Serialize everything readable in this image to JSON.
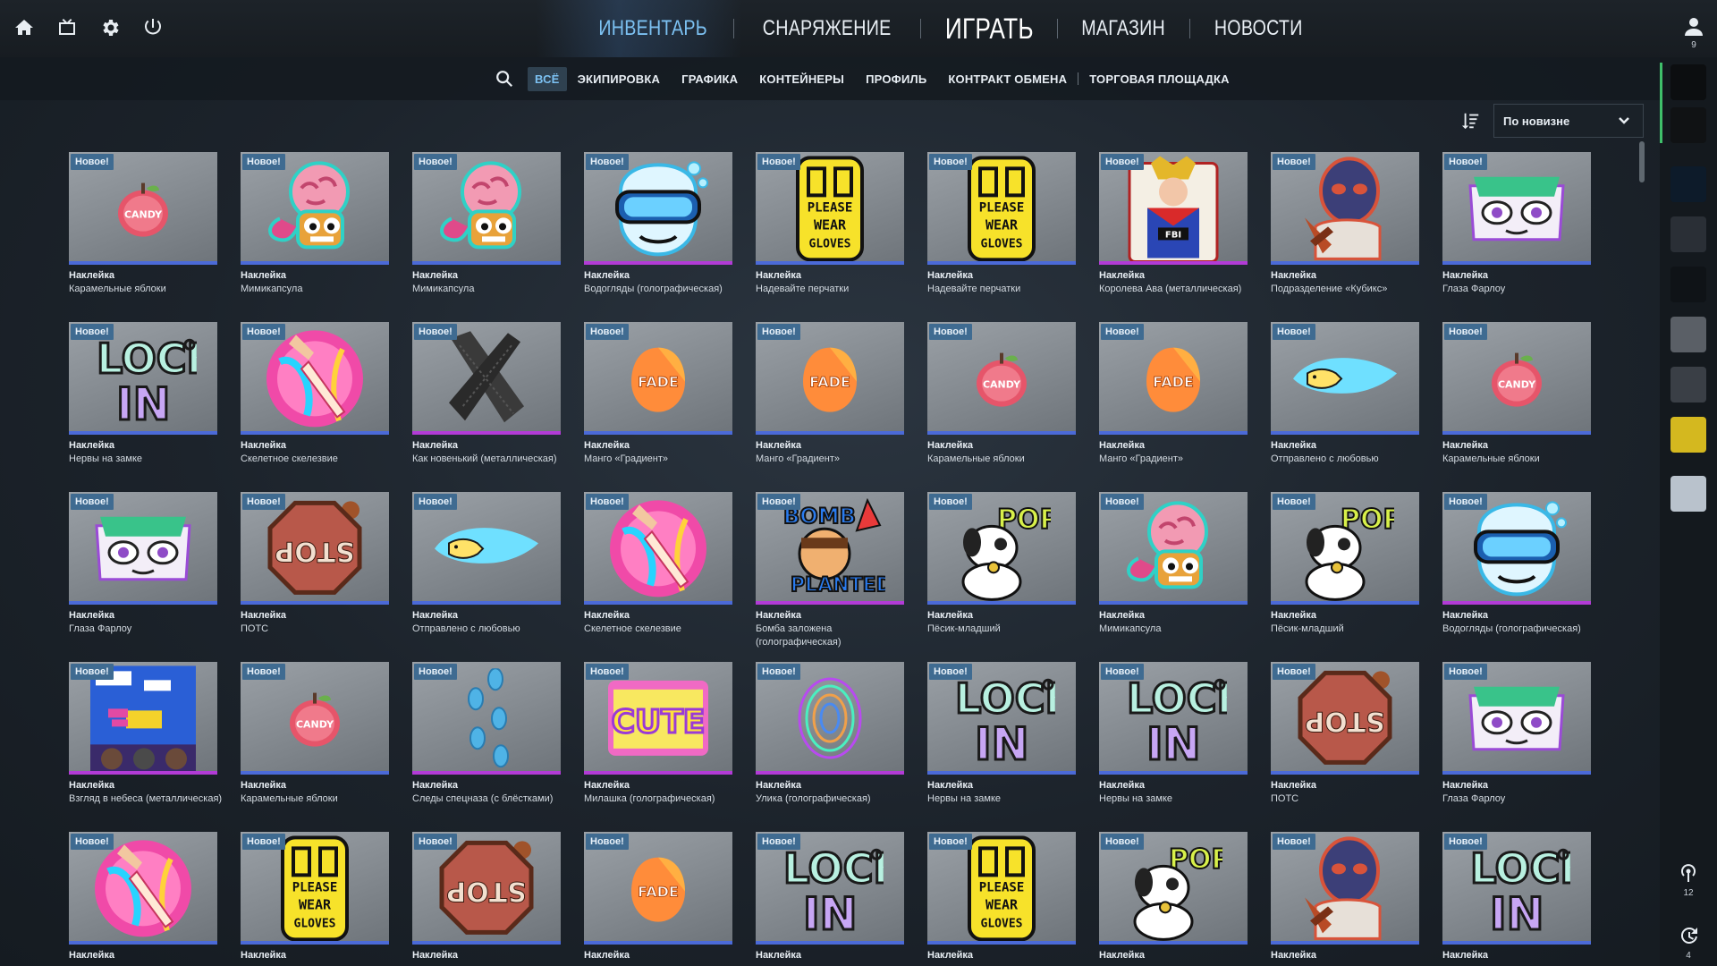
{
  "nav": {
    "items": [
      "ИНВЕНТАРЬ",
      "СНАРЯЖЕНИЕ",
      "ИГРАТЬ",
      "МАГАЗИН",
      "НОВОСТИ"
    ],
    "active": "ИНВЕНТАРЬ"
  },
  "user": {
    "friends_count": "9"
  },
  "subnav": {
    "items": [
      "ВСЁ",
      "ЭКИПИРОВКА",
      "ГРАФИКА",
      "КОНТЕЙНЕРЫ",
      "ПРОФИЛЬ",
      "КОНТРАКТ ОБМЕНА",
      "ТОРГОВАЯ ПЛОЩАДКА"
    ],
    "active": "ВСЁ"
  },
  "sort": {
    "selected": "По новизне"
  },
  "badge_text": "Новое!",
  "colors": {
    "accent": "#7cc1f2",
    "badge": "#3f6b91",
    "rarity_blue": "#4b6ad8",
    "rarity_pink": "#b23bd6"
  },
  "items": [
    {
      "type": "Наклейка",
      "name": "Карамельные яблоки",
      "art": "apple",
      "rarity": "blue"
    },
    {
      "type": "Наклейка",
      "name": "Мимикапсула",
      "art": "brain",
      "rarity": "blue"
    },
    {
      "type": "Наклейка",
      "name": "Мимикапсула",
      "art": "brain",
      "rarity": "blue"
    },
    {
      "type": "Наклейка",
      "name": "Водогляды (голографическая)",
      "art": "goggles",
      "rarity": "pink"
    },
    {
      "type": "Наклейка",
      "name": "Надевайте перчатки",
      "art": "gloves",
      "rarity": "blue"
    },
    {
      "type": "Наклейка",
      "name": "Надевайте перчатки",
      "art": "gloves",
      "rarity": "blue"
    },
    {
      "type": "Наклейка",
      "name": "Королева Ава (металлическая)",
      "art": "queen",
      "rarity": "pink"
    },
    {
      "type": "Наклейка",
      "name": "Подразделение «Кубикс»",
      "art": "mask",
      "rarity": "blue"
    },
    {
      "type": "Наклейка",
      "name": "Глаза Фарлоу",
      "art": "eyes",
      "rarity": "blue"
    },
    {
      "type": "Наклейка",
      "name": "Нервы на замке",
      "art": "lockin",
      "rarity": "blue"
    },
    {
      "type": "Наклейка",
      "name": "Скелетное скелезвие",
      "art": "knife",
      "rarity": "blue"
    },
    {
      "type": "Наклейка",
      "name": "Как новенький (металлическая)",
      "art": "tape",
      "rarity": "pink"
    },
    {
      "type": "Наклейка",
      "name": "Манго «Градиент»",
      "art": "mango",
      "rarity": "blue"
    },
    {
      "type": "Наклейка",
      "name": "Манго «Градиент»",
      "art": "mango",
      "rarity": "blue"
    },
    {
      "type": "Наклейка",
      "name": "Карамельные яблоки",
      "art": "apple",
      "rarity": "blue"
    },
    {
      "type": "Наклейка",
      "name": "Манго «Градиент»",
      "art": "mango",
      "rarity": "blue"
    },
    {
      "type": "Наклейка",
      "name": "Отправлено с любовью",
      "art": "bullet",
      "rarity": "blue"
    },
    {
      "type": "Наклейка",
      "name": "Карамельные яблоки",
      "art": "apple",
      "rarity": "blue"
    },
    {
      "type": "Наклейка",
      "name": "Глаза Фарлоу",
      "art": "eyes",
      "rarity": "blue"
    },
    {
      "type": "Наклейка",
      "name": "ПОТС",
      "art": "stop",
      "rarity": "blue"
    },
    {
      "type": "Наклейка",
      "name": "Отправлено с любовью",
      "art": "bullet",
      "rarity": "blue"
    },
    {
      "type": "Наклейка",
      "name": "Скелетное скелезвие",
      "art": "knife",
      "rarity": "blue"
    },
    {
      "type": "Наклейка",
      "name": "Бомба заложена (голографическая)",
      "art": "bomb",
      "rarity": "pink"
    },
    {
      "type": "Наклейка",
      "name": "Пёсик-младший",
      "art": "dog",
      "rarity": "blue"
    },
    {
      "type": "Наклейка",
      "name": "Мимикапсула",
      "art": "brain",
      "rarity": "blue"
    },
    {
      "type": "Наклейка",
      "name": "Пёсик-младший",
      "art": "dog",
      "rarity": "blue"
    },
    {
      "type": "Наклейка",
      "name": "Водогляды (голографическая)",
      "art": "goggles",
      "rarity": "pink"
    },
    {
      "type": "Наклейка",
      "name": "Взгляд в небеса (металлическая)",
      "art": "sky",
      "rarity": "pink"
    },
    {
      "type": "Наклейка",
      "name": "Карамельные яблоки",
      "art": "apple",
      "rarity": "blue"
    },
    {
      "type": "Наклейка",
      "name": "Следы спецназа (с блёстками)",
      "art": "steps",
      "rarity": "pink"
    },
    {
      "type": "Наклейка",
      "name": "Милашка (голографическая)",
      "art": "cute",
      "rarity": "pink"
    },
    {
      "type": "Наклейка",
      "name": "Улика (голографическая)",
      "art": "print",
      "rarity": "pink"
    },
    {
      "type": "Наклейка",
      "name": "Нервы на замке",
      "art": "lockin",
      "rarity": "blue"
    },
    {
      "type": "Наклейка",
      "name": "Нервы на замке",
      "art": "lockin",
      "rarity": "blue"
    },
    {
      "type": "Наклейка",
      "name": "ПОТС",
      "art": "stop",
      "rarity": "blue"
    },
    {
      "type": "Наклейка",
      "name": "Глаза Фарлоу",
      "art": "eyes",
      "rarity": "blue"
    },
    {
      "type": "Наклейка",
      "name": "",
      "art": "knife",
      "rarity": "blue"
    },
    {
      "type": "Наклейка",
      "name": "",
      "art": "gloves",
      "rarity": "blue"
    },
    {
      "type": "Наклейка",
      "name": "",
      "art": "stop",
      "rarity": "blue"
    },
    {
      "type": "Наклейка",
      "name": "",
      "art": "mango",
      "rarity": "blue"
    },
    {
      "type": "Наклейка",
      "name": "",
      "art": "lockin",
      "rarity": "blue"
    },
    {
      "type": "Наклейка",
      "name": "",
      "art": "gloves",
      "rarity": "blue"
    },
    {
      "type": "Наклейка",
      "name": "",
      "art": "dog",
      "rarity": "blue"
    },
    {
      "type": "Наклейка",
      "name": "",
      "art": "mask",
      "rarity": "blue"
    },
    {
      "type": "Наклейка",
      "name": "",
      "art": "lockin",
      "rarity": "blue"
    }
  ],
  "rail": {
    "bottom_counts": [
      "12",
      "4"
    ]
  }
}
